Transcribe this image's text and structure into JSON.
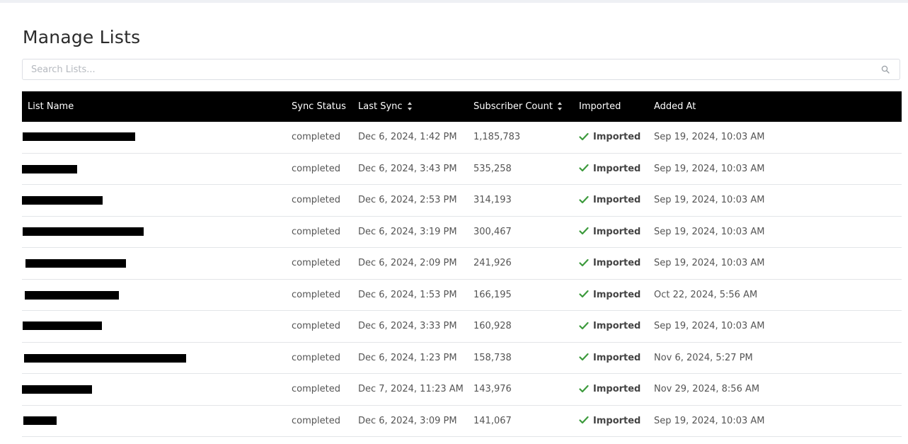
{
  "page": {
    "title": "Manage Lists"
  },
  "search": {
    "placeholder": "Search Lists..."
  },
  "table": {
    "headers": {
      "list_name": "List Name",
      "sync_status": "Sync Status",
      "last_sync": "Last Sync",
      "subscriber_count": "Subscriber Count",
      "imported": "Imported",
      "added_at": "Added At"
    },
    "rows": [
      {
        "sync_status": "completed",
        "last_sync": "Dec 6, 2024, 1:42 PM",
        "subscriber_count": "1,185,783",
        "imported": "Imported",
        "added_at": "Sep 19, 2024, 10:03 AM"
      },
      {
        "sync_status": "completed",
        "last_sync": "Dec 6, 2024, 3:43 PM",
        "subscriber_count": "535,258",
        "imported": "Imported",
        "added_at": "Sep 19, 2024, 10:03 AM"
      },
      {
        "sync_status": "completed",
        "last_sync": "Dec 6, 2024, 2:53 PM",
        "subscriber_count": "314,193",
        "imported": "Imported",
        "added_at": "Sep 19, 2024, 10:03 AM"
      },
      {
        "sync_status": "completed",
        "last_sync": "Dec 6, 2024, 3:19 PM",
        "subscriber_count": "300,467",
        "imported": "Imported",
        "added_at": "Sep 19, 2024, 10:03 AM"
      },
      {
        "sync_status": "completed",
        "last_sync": "Dec 6, 2024, 2:09 PM",
        "subscriber_count": "241,926",
        "imported": "Imported",
        "added_at": "Sep 19, 2024, 10:03 AM"
      },
      {
        "sync_status": "completed",
        "last_sync": "Dec 6, 2024, 1:53 PM",
        "subscriber_count": "166,195",
        "imported": "Imported",
        "added_at": "Oct 22, 2024, 5:56 AM"
      },
      {
        "sync_status": "completed",
        "last_sync": "Dec 6, 2024, 3:33 PM",
        "subscriber_count": "160,928",
        "imported": "Imported",
        "added_at": "Sep 19, 2024, 10:03 AM"
      },
      {
        "sync_status": "completed",
        "last_sync": "Dec 6, 2024, 1:23 PM",
        "subscriber_count": "158,738",
        "imported": "Imported",
        "added_at": "Nov 6, 2024, 5:27 PM"
      },
      {
        "sync_status": "completed",
        "last_sync": "Dec 7, 2024, 11:23 AM",
        "subscriber_count": "143,976",
        "imported": "Imported",
        "added_at": "Nov 29, 2024, 8:56 AM"
      },
      {
        "sync_status": "completed",
        "last_sync": "Dec 6, 2024, 3:09 PM",
        "subscriber_count": "141,067",
        "imported": "Imported",
        "added_at": "Sep 19, 2024, 10:03 AM"
      }
    ]
  },
  "icons": {
    "search": "search-icon",
    "sort": "sort-icon",
    "check": "check-icon"
  },
  "colors": {
    "header_bg": "#000000",
    "check": "#3c9a3c",
    "border": "#e3e5e8"
  }
}
